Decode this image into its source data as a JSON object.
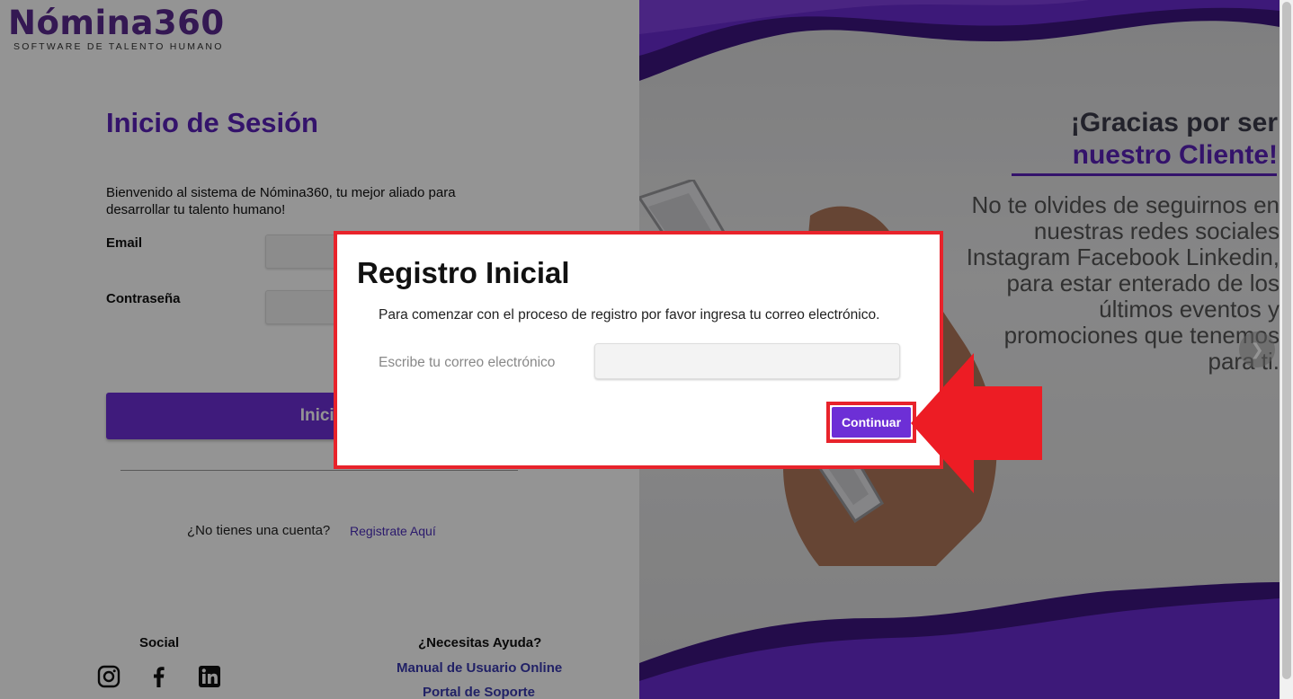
{
  "logo": {
    "brand": "Nómina360",
    "tagline": "SOFTWARE DE TALENTO HUMANO"
  },
  "login": {
    "title": "Inicio de Sesión",
    "welcome": "Bienvenido al sistema de Nómina360, tu mejor aliado para desarrollar tu talento humano!",
    "email_label": "Email",
    "password_label": "Contraseña",
    "submit_label": "Inicia",
    "no_account": "¿No tienes una cuenta?",
    "register_link": "Registrate Aquí"
  },
  "footer": {
    "social_title": "Social",
    "social_icons": [
      "instagram-icon",
      "facebook-icon",
      "linkedin-icon"
    ],
    "help_title": "¿Necesitas Ayuda?",
    "help_links": [
      "Manual de Usuario Online",
      "Portal de Soporte"
    ]
  },
  "hero": {
    "title_line1": "¡Gracias por ser",
    "title_line2": "nuestro Cliente!",
    "body": "No te olvides de seguirnos en nuestras redes sociales Instagram Facebook Linkedin, para estar enterado de los últimos eventos y promociones que tenemos para ti.",
    "next_icon": "chevron-right-icon"
  },
  "modal": {
    "title": "Registro Inicial",
    "description": "Para comenzar con el proceso de registro por favor ingresa tu correo electrónico.",
    "email_label": "Escribe tu correo electrónico",
    "email_value": "",
    "continue_label": "Continuar"
  },
  "colors": {
    "brand_purple": "#6d2fd6",
    "title_purple": "#5a22b8",
    "highlight_red": "#e8232b"
  }
}
